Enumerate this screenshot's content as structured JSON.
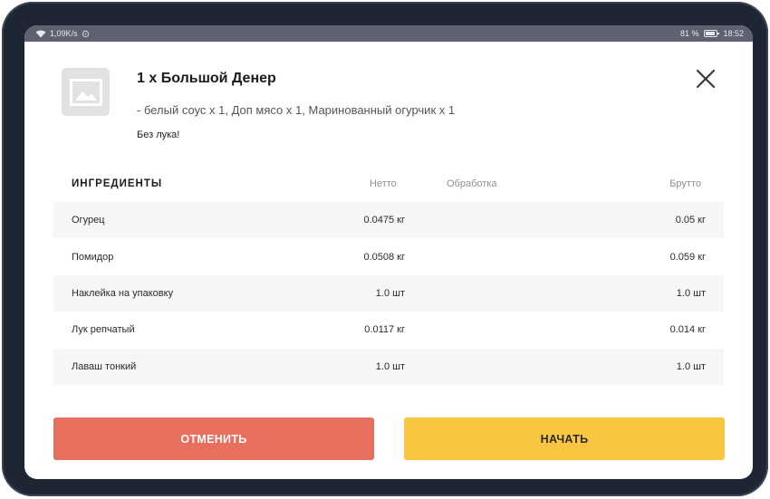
{
  "status_bar": {
    "speed": "1,09K/s",
    "battery": "81 %",
    "time": "18:52"
  },
  "order": {
    "title": "1 x Большой Денер",
    "modifiers": "- белый соус x 1, Доп мясо x 1, Маринованный огурчик x 1",
    "note": "Без лука!"
  },
  "table": {
    "headers": {
      "name": "ИНГРЕДИЕНТЫ",
      "netto": "Нетто",
      "processing": "Обработка",
      "brutto": "Брутто"
    },
    "rows": [
      {
        "name": "Огурец",
        "netto": "0.0475 кг",
        "processing": "",
        "brutto": "0.05 кг"
      },
      {
        "name": "Помидор",
        "netto": "0.0508 кг",
        "processing": "",
        "brutto": "0.059 кг"
      },
      {
        "name": "Наклейка на упаковку",
        "netto": "1.0 шт",
        "processing": "",
        "brutto": "1.0 шт"
      },
      {
        "name": "Лук репчатый",
        "netto": "0.0117 кг",
        "processing": "",
        "brutto": "0.014 кг"
      },
      {
        "name": "Лаваш тонкий",
        "netto": "1.0 шт",
        "processing": "",
        "brutto": "1.0 шт"
      }
    ]
  },
  "buttons": {
    "cancel": "ОТМЕНИТЬ",
    "start": "НАЧАТЬ"
  },
  "colors": {
    "cancel": "#e86f5e",
    "start": "#fbc63f",
    "row_shade": "#f6f6f6"
  },
  "icons": {
    "thumbnail": "image-placeholder-icon",
    "close": "close-icon",
    "wifi": "wifi-icon",
    "battery": "battery-icon"
  }
}
